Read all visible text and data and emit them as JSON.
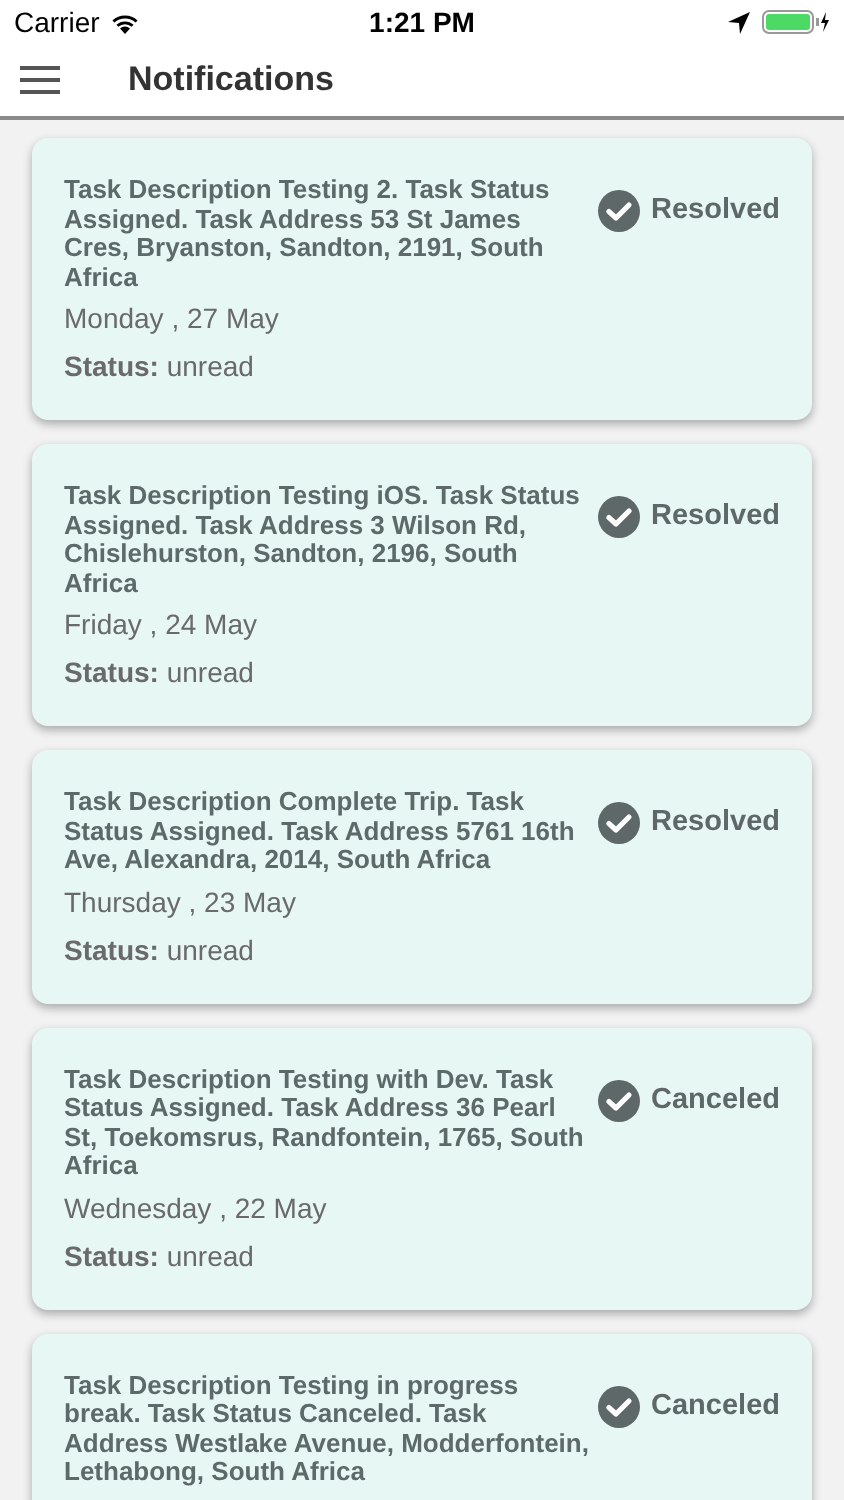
{
  "status_bar": {
    "carrier": "Carrier",
    "time": "1:21 PM"
  },
  "header": {
    "title": "Notifications"
  },
  "notifications": [
    {
      "description": "Task Description Testing 2. Task Status Assigned. Task Address 53 St James Cres, Bryanston, Sandton, 2191, South Africa",
      "badge": "Resolved",
      "date": "Monday , 27 May",
      "status": "**Status:** unread"
    },
    {
      "description": "Task Description Testing iOS. Task Status Assigned. Task Address 3 Wilson Rd, Chislehurston, Sandton, 2196, South Africa",
      "badge": "Resolved",
      "date": "Friday , 24 May",
      "status": "**Status:** unread"
    },
    {
      "description": "Task Description Complete Trip. Task Status Assigned. Task Address 5761 16th Ave, Alexandra, 2014, South Africa",
      "badge": "Resolved",
      "date": "Thursday , 23 May",
      "status": "**Status:** unread"
    },
    {
      "description": "Task Description Testing with Dev. Task Status Assigned. Task Address 36 Pearl St, Toekomsrus, Randfontein, 1765, South Africa",
      "badge": "Canceled",
      "date": "Wednesday , 22 May",
      "status": "**Status:** unread"
    },
    {
      "description": "Task Description Testing in progress break. Task Status Canceled. Task Address Westlake Avenue, Modderfontein, Lethabong, South Africa",
      "badge": "Canceled"
    }
  ]
}
